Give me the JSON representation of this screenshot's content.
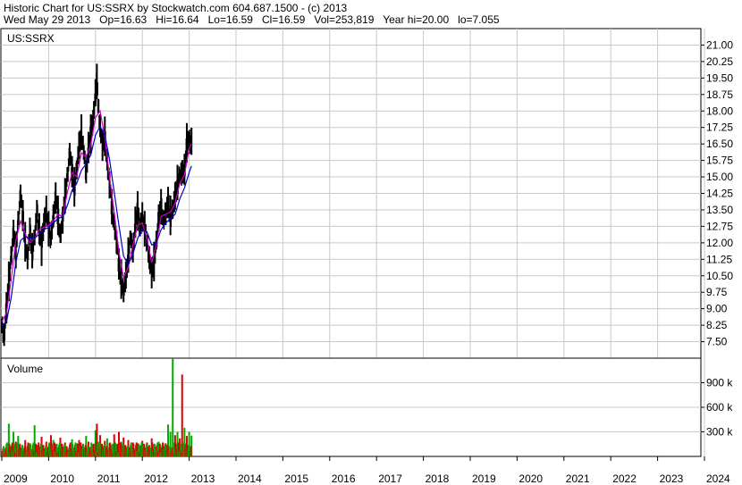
{
  "header": {
    "title": "Historic Chart for US:SSRX by Stockwatch.com 604.687.1500 - (c) 2013",
    "summary": "Wed May 29 2013   Op=16.63   Hi=16.64   Lo=16.59   Cl=16.59   Vol=253,819   Year hi=20.00   lo=7.055"
  },
  "chart_data": {
    "type": "line",
    "x_axis": {
      "ticks": [
        "2009",
        "2010",
        "2011",
        "2012",
        "2013",
        "2014",
        "2015",
        "2016",
        "2017",
        "2018",
        "2019",
        "2020",
        "2021",
        "2022",
        "2023",
        "2024"
      ]
    },
    "price_panel": {
      "symbol": "US:SSRX",
      "y_ticks": [
        "21.00",
        "20.25",
        "19.50",
        "18.75",
        "18.00",
        "17.25",
        "16.50",
        "15.75",
        "15.00",
        "14.25",
        "13.50",
        "12.75",
        "12.00",
        "11.25",
        "10.50",
        "9.75",
        "9.00",
        "8.25",
        "7.50"
      ],
      "ylim": [
        6.75,
        21.75
      ],
      "series": [
        {
          "type": "price-bars",
          "color": "#000000",
          "points": [
            [
              2009.0,
              8.2
            ],
            [
              2009.05,
              7.8
            ],
            [
              2009.1,
              9.0
            ],
            [
              2009.15,
              10.2
            ],
            [
              2009.2,
              11.4
            ],
            [
              2009.25,
              12.4
            ],
            [
              2009.3,
              11.6
            ],
            [
              2009.35,
              13.1
            ],
            [
              2009.4,
              14.1
            ],
            [
              2009.45,
              13.2
            ],
            [
              2009.5,
              12.0
            ],
            [
              2009.55,
              11.2
            ],
            [
              2009.6,
              12.5
            ],
            [
              2009.65,
              11.6
            ],
            [
              2009.7,
              12.2
            ],
            [
              2009.75,
              13.4
            ],
            [
              2009.8,
              12.6
            ],
            [
              2009.85,
              11.8
            ],
            [
              2009.9,
              12.9
            ],
            [
              2009.95,
              13.5
            ],
            [
              2010.0,
              12.6
            ],
            [
              2010.05,
              12.2
            ],
            [
              2010.1,
              13.2
            ],
            [
              2010.15,
              14.0
            ],
            [
              2010.2,
              13.2
            ],
            [
              2010.25,
              12.4
            ],
            [
              2010.3,
              13.0
            ],
            [
              2010.35,
              14.1
            ],
            [
              2010.4,
              15.1
            ],
            [
              2010.45,
              16.0
            ],
            [
              2010.5,
              15.2
            ],
            [
              2010.55,
              14.5
            ],
            [
              2010.6,
              15.3
            ],
            [
              2010.65,
              16.4
            ],
            [
              2010.7,
              17.0
            ],
            [
              2010.75,
              16.1
            ],
            [
              2010.8,
              15.2
            ],
            [
              2010.85,
              16.3
            ],
            [
              2010.9,
              16.9
            ],
            [
              2010.95,
              17.6
            ],
            [
              2011.0,
              18.8
            ],
            [
              2011.03,
              19.3
            ],
            [
              2011.06,
              18.2
            ],
            [
              2011.1,
              17.3
            ],
            [
              2011.15,
              16.4
            ],
            [
              2011.2,
              16.8
            ],
            [
              2011.25,
              15.7
            ],
            [
              2011.3,
              14.6
            ],
            [
              2011.35,
              13.6
            ],
            [
              2011.4,
              12.9
            ],
            [
              2011.45,
              12.0
            ],
            [
              2011.5,
              11.0
            ],
            [
              2011.55,
              10.3
            ],
            [
              2011.6,
              9.7
            ],
            [
              2011.65,
              10.5
            ],
            [
              2011.7,
              11.4
            ],
            [
              2011.75,
              12.2
            ],
            [
              2011.8,
              11.6
            ],
            [
              2011.85,
              12.9
            ],
            [
              2011.9,
              13.4
            ],
            [
              2011.95,
              12.7
            ],
            [
              2012.0,
              13.2
            ],
            [
              2012.05,
              12.6
            ],
            [
              2012.1,
              12.0
            ],
            [
              2012.15,
              11.3
            ],
            [
              2012.2,
              10.6
            ],
            [
              2012.25,
              11.1
            ],
            [
              2012.3,
              12.1
            ],
            [
              2012.35,
              13.1
            ],
            [
              2012.4,
              13.6
            ],
            [
              2012.45,
              13.1
            ],
            [
              2012.5,
              13.3
            ],
            [
              2012.55,
              13.8
            ],
            [
              2012.6,
              13.2
            ],
            [
              2012.65,
              13.5
            ],
            [
              2012.7,
              14.1
            ],
            [
              2012.75,
              14.7
            ],
            [
              2012.8,
              15.0
            ],
            [
              2012.85,
              15.2
            ],
            [
              2012.9,
              15.3
            ],
            [
              2012.95,
              16.5
            ],
            [
              2013.0,
              16.6
            ],
            [
              2013.05,
              16.59
            ]
          ]
        },
        {
          "type": "line",
          "color": "#cc00cc",
          "points": [
            [
              2009.0,
              8.4
            ],
            [
              2009.1,
              8.8
            ],
            [
              2009.2,
              10.3
            ],
            [
              2009.3,
              12.1
            ],
            [
              2009.4,
              13.0
            ],
            [
              2009.5,
              12.4
            ],
            [
              2009.6,
              12.0
            ],
            [
              2009.7,
              12.2
            ],
            [
              2009.8,
              12.6
            ],
            [
              2009.9,
              12.7
            ],
            [
              2010.0,
              12.8
            ],
            [
              2010.1,
              13.0
            ],
            [
              2010.2,
              13.3
            ],
            [
              2010.3,
              13.2
            ],
            [
              2010.4,
              14.3
            ],
            [
              2010.5,
              15.2
            ],
            [
              2010.6,
              15.0
            ],
            [
              2010.7,
              16.1
            ],
            [
              2010.8,
              15.9
            ],
            [
              2010.9,
              16.5
            ],
            [
              2011.0,
              17.7
            ],
            [
              2011.1,
              18.0
            ],
            [
              2011.2,
              16.8
            ],
            [
              2011.3,
              15.0
            ],
            [
              2011.4,
              13.4
            ],
            [
              2011.5,
              11.6
            ],
            [
              2011.6,
              10.4
            ],
            [
              2011.7,
              10.9
            ],
            [
              2011.8,
              11.9
            ],
            [
              2011.9,
              12.8
            ],
            [
              2012.0,
              12.9
            ],
            [
              2012.1,
              12.2
            ],
            [
              2012.2,
              11.1
            ],
            [
              2012.3,
              11.9
            ],
            [
              2012.4,
              13.2
            ],
            [
              2012.5,
              13.3
            ],
            [
              2012.6,
              13.4
            ],
            [
              2012.7,
              13.8
            ],
            [
              2012.8,
              14.7
            ],
            [
              2012.9,
              15.1
            ],
            [
              2013.0,
              16.3
            ],
            [
              2013.05,
              16.5
            ]
          ]
        },
        {
          "type": "line",
          "color": "#0000cc",
          "points": [
            [
              2009.0,
              8.2
            ],
            [
              2009.1,
              8.4
            ],
            [
              2009.2,
              9.5
            ],
            [
              2009.3,
              11.1
            ],
            [
              2009.4,
              12.1
            ],
            [
              2009.5,
              12.3
            ],
            [
              2009.6,
              12.2
            ],
            [
              2009.7,
              12.2
            ],
            [
              2009.8,
              12.4
            ],
            [
              2009.9,
              12.6
            ],
            [
              2010.0,
              12.7
            ],
            [
              2010.1,
              12.9
            ],
            [
              2010.2,
              13.1
            ],
            [
              2010.3,
              13.2
            ],
            [
              2010.4,
              13.7
            ],
            [
              2010.5,
              14.4
            ],
            [
              2010.6,
              14.7
            ],
            [
              2010.7,
              15.3
            ],
            [
              2010.8,
              15.6
            ],
            [
              2010.9,
              16.0
            ],
            [
              2011.0,
              16.9
            ],
            [
              2011.1,
              17.3
            ],
            [
              2011.2,
              16.9
            ],
            [
              2011.3,
              15.8
            ],
            [
              2011.4,
              14.3
            ],
            [
              2011.5,
              12.8
            ],
            [
              2011.6,
              11.4
            ],
            [
              2011.7,
              11.0
            ],
            [
              2011.8,
              11.5
            ],
            [
              2011.9,
              12.2
            ],
            [
              2012.0,
              12.6
            ],
            [
              2012.1,
              12.5
            ],
            [
              2012.2,
              11.9
            ],
            [
              2012.3,
              12.0
            ],
            [
              2012.4,
              12.6
            ],
            [
              2012.5,
              12.9
            ],
            [
              2012.6,
              13.1
            ],
            [
              2012.7,
              13.3
            ],
            [
              2012.8,
              14.0
            ],
            [
              2012.9,
              14.5
            ],
            [
              2013.0,
              15.2
            ],
            [
              2013.05,
              15.5
            ]
          ]
        }
      ]
    },
    "volume_panel": {
      "title": "Volume",
      "y_ticks": [
        "900 k",
        "600 k",
        "300 k"
      ],
      "y_tick_values": [
        900000,
        600000,
        300000
      ],
      "ylim": [
        0,
        1200000
      ],
      "colors": {
        "up": "#00aa00",
        "down": "#dd0000"
      },
      "bars": [
        [
          2009.0,
          60000,
          "down"
        ],
        [
          2009.05,
          90000,
          "up"
        ],
        [
          2009.1,
          150000,
          "up"
        ],
        [
          2009.15,
          400000,
          "up"
        ],
        [
          2009.2,
          120000,
          "down"
        ],
        [
          2009.25,
          300000,
          "up"
        ],
        [
          2009.3,
          180000,
          "down"
        ],
        [
          2009.35,
          250000,
          "up"
        ],
        [
          2009.4,
          100000,
          "down"
        ],
        [
          2009.45,
          80000,
          "up"
        ],
        [
          2009.5,
          200000,
          "down"
        ],
        [
          2009.55,
          130000,
          "up"
        ],
        [
          2009.6,
          160000,
          "up"
        ],
        [
          2009.65,
          90000,
          "down"
        ],
        [
          2009.7,
          380000,
          "up"
        ],
        [
          2009.75,
          140000,
          "down"
        ],
        [
          2009.8,
          110000,
          "up"
        ],
        [
          2009.85,
          240000,
          "down"
        ],
        [
          2009.9,
          100000,
          "up"
        ],
        [
          2009.95,
          180000,
          "down"
        ],
        [
          2010.0,
          130000,
          "up"
        ],
        [
          2010.05,
          260000,
          "down"
        ],
        [
          2010.1,
          200000,
          "up"
        ],
        [
          2010.15,
          150000,
          "down"
        ],
        [
          2010.2,
          100000,
          "up"
        ],
        [
          2010.25,
          230000,
          "down"
        ],
        [
          2010.3,
          120000,
          "up"
        ],
        [
          2010.35,
          170000,
          "down"
        ],
        [
          2010.4,
          90000,
          "up"
        ],
        [
          2010.45,
          140000,
          "down"
        ],
        [
          2010.5,
          210000,
          "up"
        ],
        [
          2010.55,
          110000,
          "down"
        ],
        [
          2010.6,
          160000,
          "up"
        ],
        [
          2010.65,
          200000,
          "down"
        ],
        [
          2010.7,
          130000,
          "up"
        ],
        [
          2010.75,
          90000,
          "down"
        ],
        [
          2010.8,
          250000,
          "up"
        ],
        [
          2010.85,
          180000,
          "down"
        ],
        [
          2010.9,
          120000,
          "up"
        ],
        [
          2010.95,
          150000,
          "down"
        ],
        [
          2011.0,
          320000,
          "up"
        ],
        [
          2011.03,
          400000,
          "down"
        ],
        [
          2011.06,
          180000,
          "up"
        ],
        [
          2011.1,
          260000,
          "down"
        ],
        [
          2011.15,
          130000,
          "up"
        ],
        [
          2011.2,
          190000,
          "down"
        ],
        [
          2011.25,
          220000,
          "up"
        ],
        [
          2011.3,
          160000,
          "down"
        ],
        [
          2011.35,
          140000,
          "up"
        ],
        [
          2011.4,
          270000,
          "down"
        ],
        [
          2011.45,
          150000,
          "up"
        ],
        [
          2011.5,
          300000,
          "down"
        ],
        [
          2011.55,
          180000,
          "up"
        ],
        [
          2011.6,
          230000,
          "down"
        ],
        [
          2011.65,
          120000,
          "up"
        ],
        [
          2011.7,
          200000,
          "down"
        ],
        [
          2011.75,
          140000,
          "up"
        ],
        [
          2011.8,
          170000,
          "down"
        ],
        [
          2011.85,
          100000,
          "up"
        ],
        [
          2011.9,
          160000,
          "down"
        ],
        [
          2011.95,
          130000,
          "up"
        ],
        [
          2012.0,
          190000,
          "down"
        ],
        [
          2012.05,
          110000,
          "up"
        ],
        [
          2012.1,
          170000,
          "down"
        ],
        [
          2012.15,
          140000,
          "up"
        ],
        [
          2012.2,
          220000,
          "down"
        ],
        [
          2012.25,
          150000,
          "up"
        ],
        [
          2012.3,
          120000,
          "down"
        ],
        [
          2012.35,
          180000,
          "up"
        ],
        [
          2012.4,
          100000,
          "down"
        ],
        [
          2012.45,
          130000,
          "up"
        ],
        [
          2012.5,
          160000,
          "down"
        ],
        [
          2012.55,
          390000,
          "up"
        ],
        [
          2012.6,
          300000,
          "up"
        ],
        [
          2012.65,
          1200000,
          "up"
        ],
        [
          2012.7,
          260000,
          "down"
        ],
        [
          2012.75,
          300000,
          "up"
        ],
        [
          2012.8,
          220000,
          "down"
        ],
        [
          2012.85,
          1000000,
          "down"
        ],
        [
          2012.9,
          350000,
          "up"
        ],
        [
          2012.95,
          250000,
          "down"
        ],
        [
          2013.0,
          300000,
          "up"
        ],
        [
          2013.05,
          253819,
          "up"
        ]
      ]
    }
  }
}
